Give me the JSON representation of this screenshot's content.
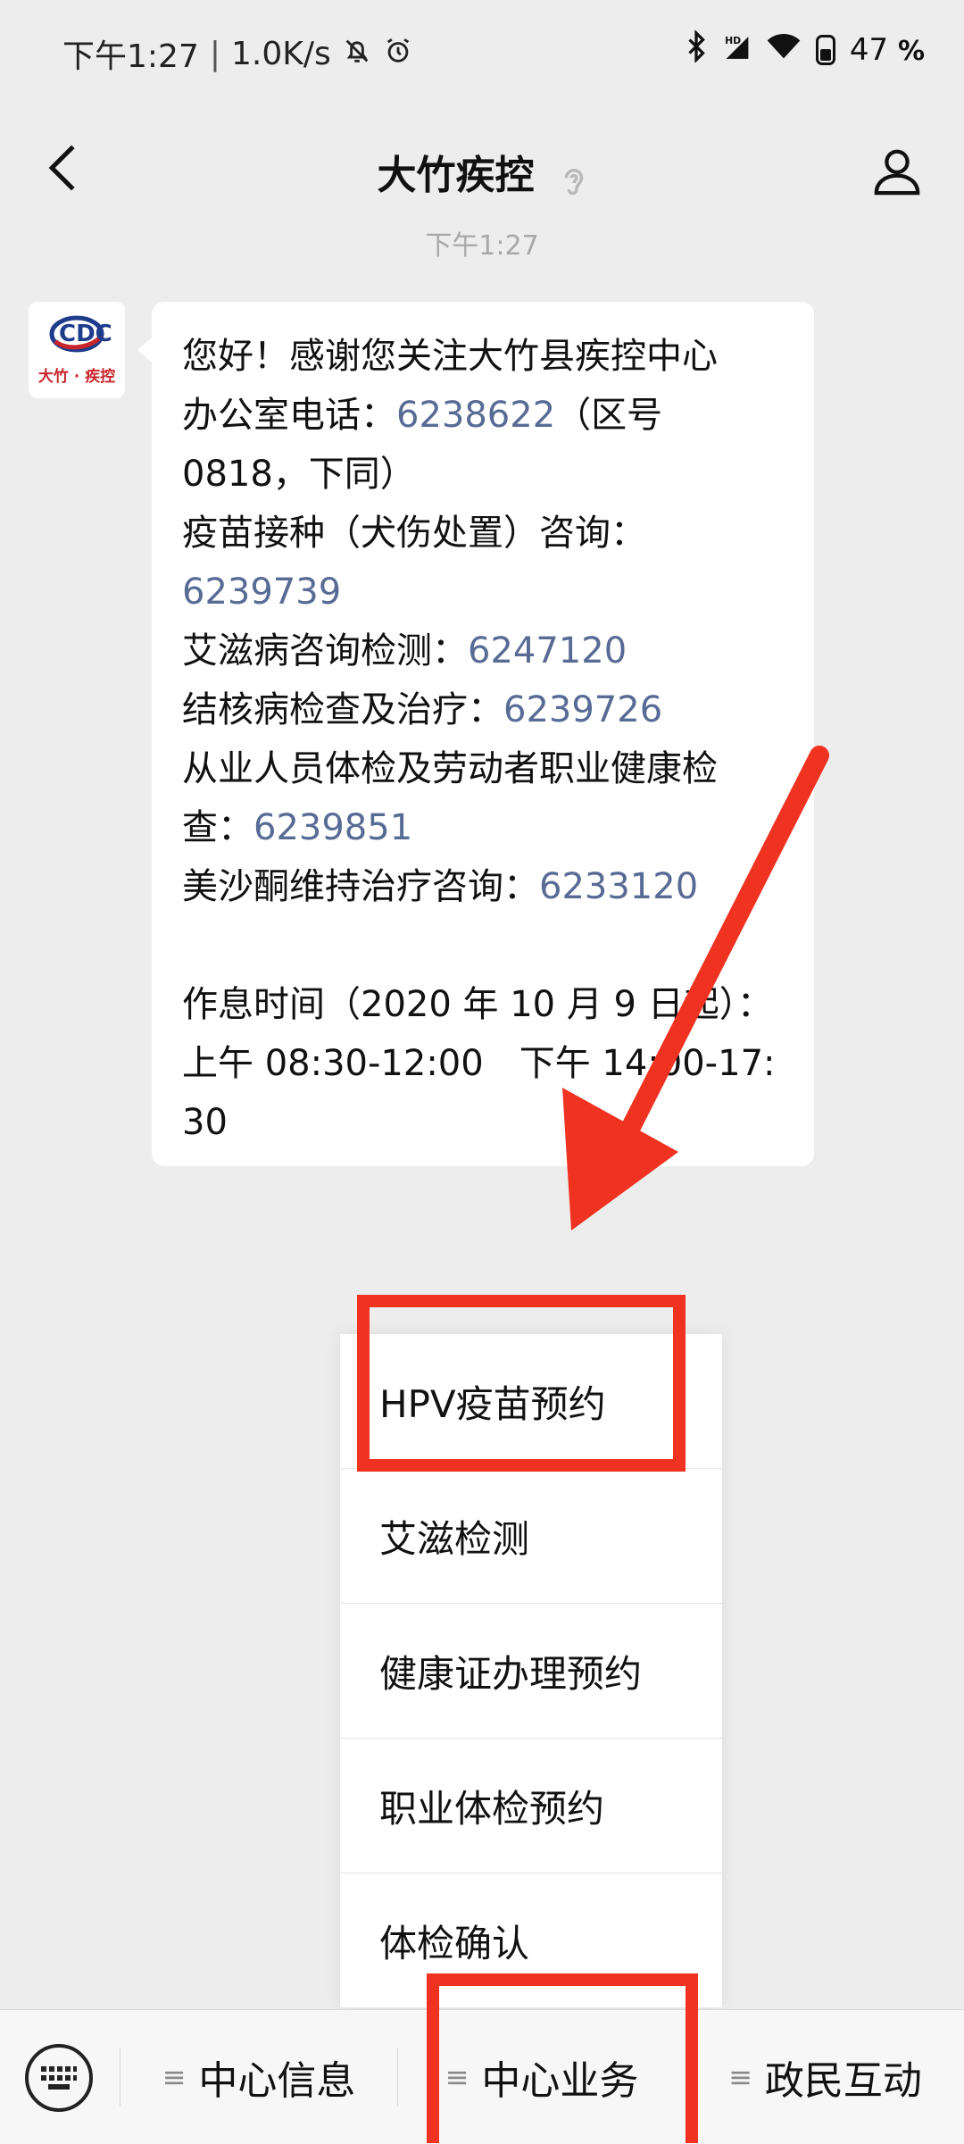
{
  "status_bar": {
    "time": "下午1:27",
    "separator": "|",
    "network_speed": "1.0K/s",
    "battery_percent": "47",
    "battery_unit": "%",
    "icons": [
      "bell-off-icon",
      "alarm-icon",
      "bluetooth-icon",
      "hd-signal-icon",
      "wifi-icon",
      "battery-icon"
    ]
  },
  "header": {
    "title": "大竹疾控",
    "icons": [
      "back-arrow-icon",
      "ear-icon",
      "profile-icon"
    ]
  },
  "chat": {
    "timestamp": "下午1:27",
    "avatar": {
      "line": "大竹 · 疾控",
      "logo_letters": "CDC"
    },
    "message": {
      "line1": "您好！感谢您关注大竹县疾控中心",
      "line2_prefix": "办公室电话：",
      "line2_phone": "6238622",
      "line2_suffix": "（区号",
      "line3": "0818，下同）",
      "line4": "疫苗接种（犬伤处置）咨询：",
      "line5_phone": "6239739",
      "line6_prefix": "艾滋病咨询检测：",
      "line6_phone": "6247120",
      "line7_prefix": "结核病检查及治疗：",
      "line7_phone": "6239726",
      "line8": "从业人员体检及劳动者职业健康检",
      "line9_prefix": "查：",
      "line9_phone": "6239851",
      "line10_prefix": "美沙酮维持治疗咨询：",
      "line10_phone": "6233120",
      "line11": "作息时间（2020 年 10 月 9 日起）：",
      "line12": "上午 08:30-12:00　下午 14:00-17:",
      "line13": "30"
    }
  },
  "popup_menu": {
    "items": [
      {
        "label": "HPV疫苗预约"
      },
      {
        "label": "艾滋检测"
      },
      {
        "label": "健康证办理预约"
      },
      {
        "label": "职业体检预约"
      },
      {
        "label": "体检确认"
      }
    ]
  },
  "tab_bar": {
    "keyboard_icon": "keyboard-icon",
    "tabs": [
      {
        "label": "中心信息",
        "icon": "menu-lines-icon"
      },
      {
        "label": "中心业务",
        "icon": "menu-lines-icon"
      },
      {
        "label": "政民互动",
        "icon": "menu-lines-icon"
      }
    ]
  },
  "annotations": {
    "color": "#f03221"
  },
  "colors": {
    "link": "#576b95",
    "background": "#ededed"
  }
}
